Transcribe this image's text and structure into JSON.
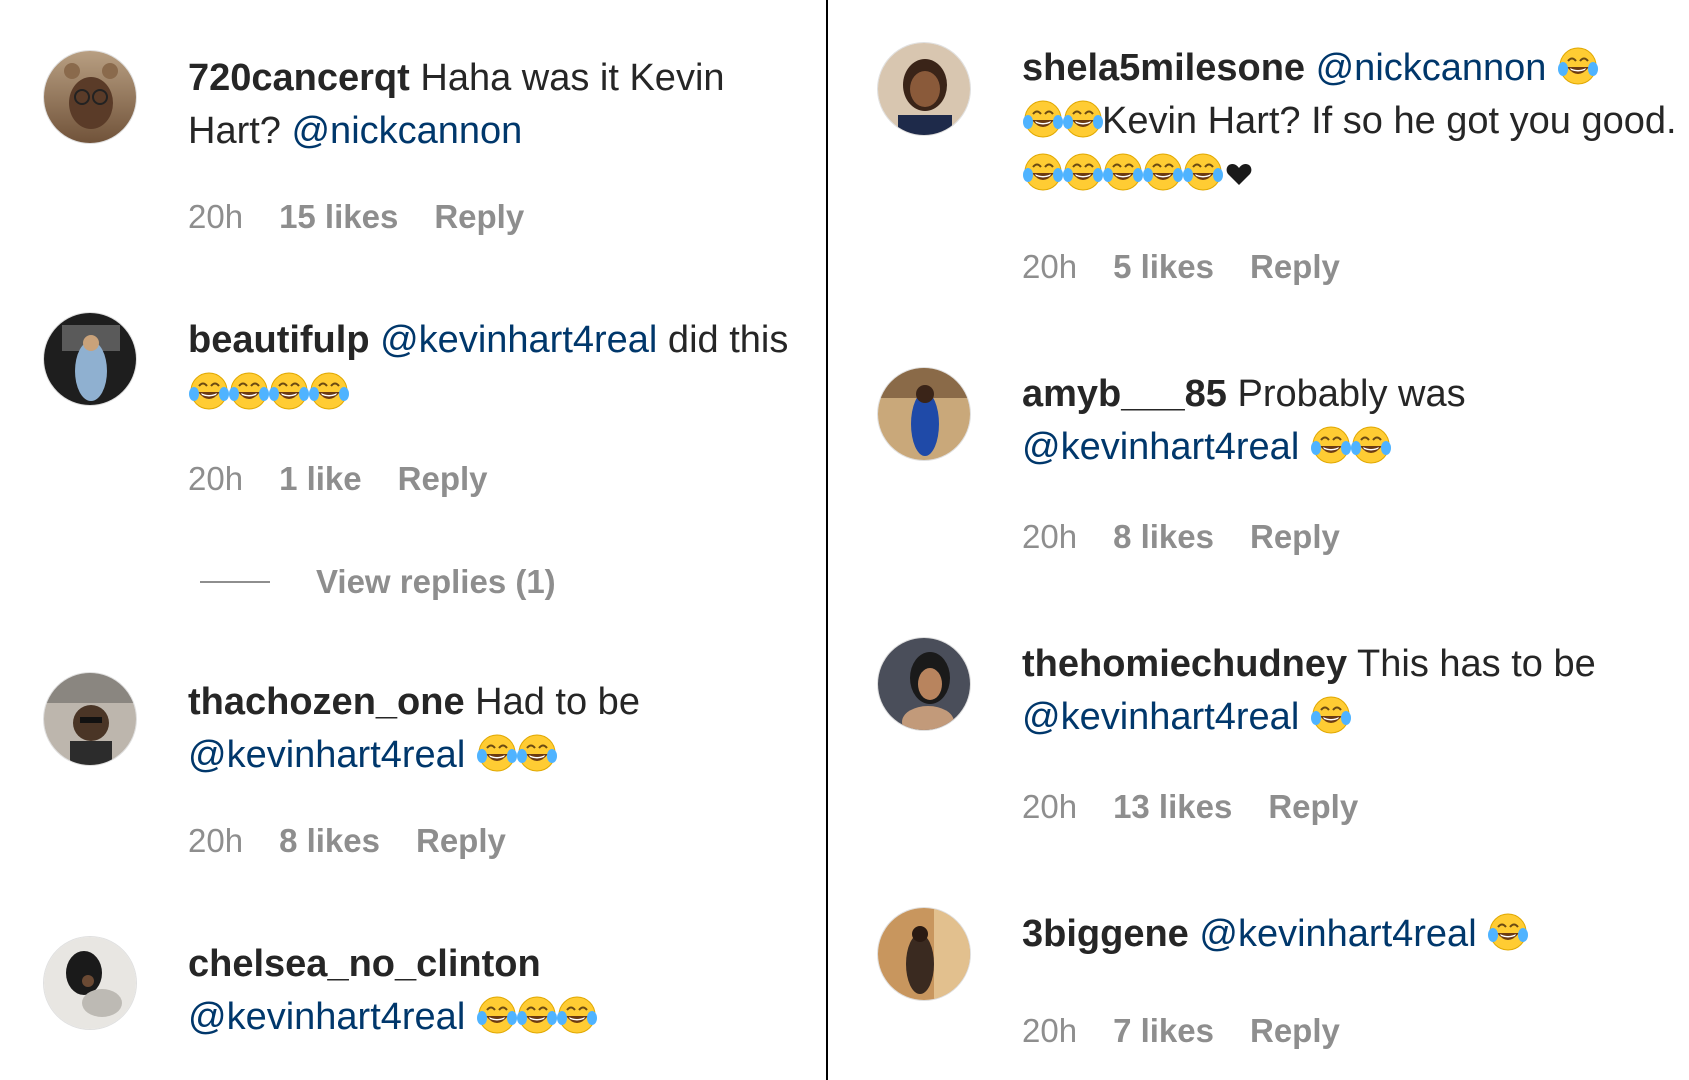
{
  "left_comments": [
    {
      "username": "720cancerqt",
      "text_before": " Haha was it Kevin Hart? ",
      "mention": "@nickcannon",
      "text_after": "",
      "emoji_count": 0,
      "time": "20h",
      "likes": "15 likes",
      "reply": "Reply",
      "avatar_colors": [
        "#8a6a4c",
        "#c9b39a"
      ]
    },
    {
      "username": "beautifulp",
      "text_before": " ",
      "mention": "@kevinhart4real",
      "text_after": " did this ",
      "emoji_count": 4,
      "time": "20h",
      "likes": "1 like",
      "reply": "Reply",
      "avatar_colors": [
        "#3a3a3a",
        "#8aa6c4"
      ]
    },
    {
      "username": "thachozen_one",
      "text_before": " Had to be ",
      "mention": "@kevinhart4real",
      "text_after": " ",
      "emoji_count": 2,
      "time": "20h",
      "likes": "8 likes",
      "reply": "Reply",
      "avatar_colors": [
        "#6a6a6a",
        "#b8b2aa"
      ]
    },
    {
      "username": "chelsea_no_clinton",
      "text_before": " ",
      "mention": "@kevinhart4real",
      "text_after": " ",
      "emoji_count": 3,
      "time": "",
      "likes": "",
      "reply": "",
      "avatar_colors": [
        "#2a2a2a",
        "#e8e8e8"
      ]
    }
  ],
  "view_replies": "View replies (1)",
  "right_comments": [
    {
      "username": "shela5milesone",
      "text_before": " ",
      "mention": "@nickcannon",
      "text_after": " ",
      "emoji_count": 3,
      "text_line2_prefix": "Kevin Hart? If so he got you good. ",
      "emoji_count2": 5,
      "heart": true,
      "time": "20h",
      "likes": "5 likes",
      "reply": "Reply",
      "avatar_colors": [
        "#5a3b2a",
        "#d9c2a8"
      ]
    },
    {
      "username": "amyb___85",
      "text_before": " Probably was ",
      "mention": "@kevinhart4real",
      "text_after": " ",
      "emoji_count": 2,
      "time": "20h",
      "likes": "8 likes",
      "reply": "Reply",
      "avatar_colors": [
        "#2a4a9a",
        "#c8a87a"
      ]
    },
    {
      "username": "thehomiechudney",
      "text_before": " This has to be ",
      "mention": "@kevinhart4real",
      "text_after": " ",
      "emoji_count": 1,
      "time": "20h",
      "likes": "13 likes",
      "reply": "Reply",
      "avatar_colors": [
        "#3a3a4a",
        "#c29a7a"
      ]
    },
    {
      "username": "3biggene",
      "text_before": " ",
      "mention": "@kevinhart4real",
      "text_after": " ",
      "emoji_count": 1,
      "time": "20h",
      "likes": "7 likes",
      "reply": "Reply",
      "avatar_colors": [
        "#6a4a2a",
        "#d8b080"
      ]
    }
  ]
}
